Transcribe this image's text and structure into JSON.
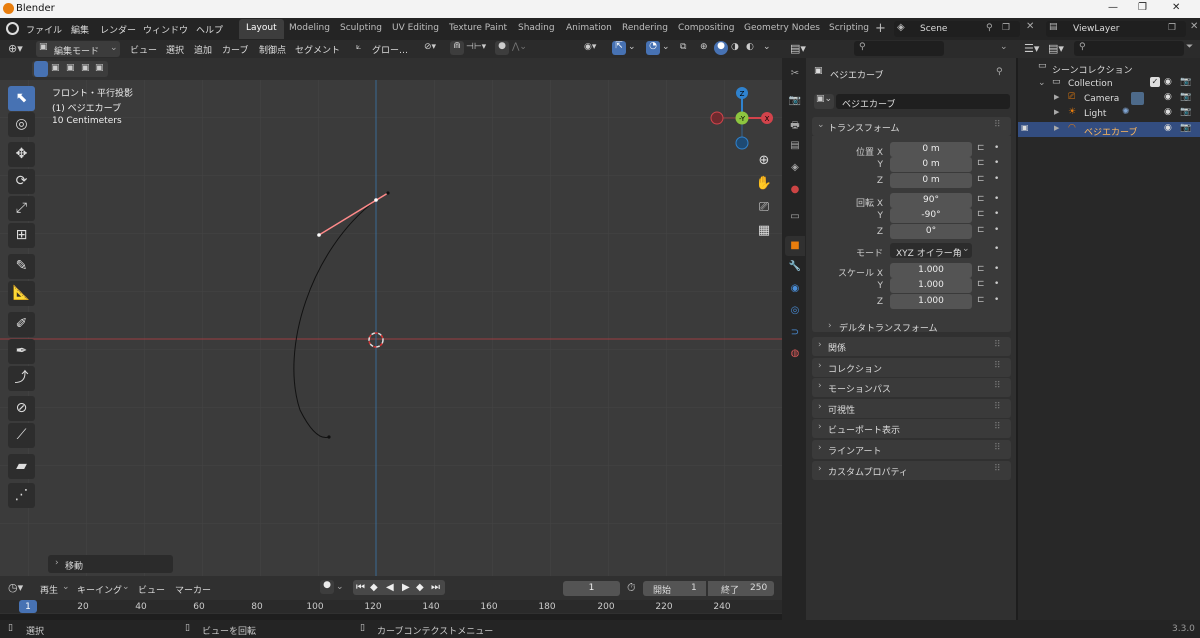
{
  "app": {
    "title": "Blender",
    "version": "3.3.0"
  },
  "menus": [
    "ファイル",
    "編集",
    "レンダー",
    "ウィンドウ",
    "ヘルプ"
  ],
  "workspaces": [
    "Layout",
    "Modeling",
    "Sculpting",
    "UV Editing",
    "Texture Paint",
    "Shading",
    "Animation",
    "Rendering",
    "Compositing",
    "Geometry Nodes",
    "Scripting"
  ],
  "active_workspace": "Layout",
  "scene": "Scene",
  "view_layer": "ViewLayer",
  "viewport_header": {
    "mode": "編集モード",
    "menus": [
      "ビュー",
      "選択",
      "追加",
      "カーブ",
      "制御点",
      "セグメント"
    ],
    "transform": "グロー…"
  },
  "overlay_text": {
    "view": "フロント・平行投影",
    "object": "(1) ベジエカーブ",
    "scale": "10 Centimeters"
  },
  "gizmo": {
    "z": "Z",
    "y": "-Y",
    "x": "X"
  },
  "operator_panel": "移動",
  "timeline": {
    "menus": [
      "再生",
      "キーイング",
      "ビュー",
      "マーカー"
    ],
    "current_frame": "1",
    "start_label": "開始",
    "start": "1",
    "end_label": "終了",
    "end": "250",
    "ticks": [
      "1",
      "20",
      "40",
      "60",
      "80",
      "100",
      "120",
      "140",
      "160",
      "180",
      "200",
      "220",
      "240"
    ]
  },
  "status": {
    "left": "選択",
    "mid": "ビューを回転",
    "right": "カーブコンテクストメニュー"
  },
  "properties": {
    "object_name": "ベジエカーブ",
    "data_name": "ベジエカーブ",
    "transform_header": "トランスフォーム",
    "location_label": "位置 X",
    "location": [
      "0 m",
      "0 m",
      "0 m"
    ],
    "rotation_label": "回転 X",
    "rotation": [
      "90°",
      "-90°",
      "0°"
    ],
    "mode_label": "モード",
    "mode_value": "XYZ オイラー角",
    "scale_label": "スケール X",
    "scale": [
      "1.000",
      "1.000",
      "1.000"
    ],
    "axis_y": "Y",
    "axis_z": "Z",
    "delta": "デルタトランスフォーム",
    "panels": [
      "関係",
      "コレクション",
      "モーションパス",
      "可視性",
      "ビューポート表示",
      "ラインアート",
      "カスタムプロパティ"
    ]
  },
  "outliner": {
    "root": "シーンコレクション",
    "collection": "Collection",
    "items": [
      "Camera",
      "Light",
      "ベジエカーブ"
    ]
  },
  "colors": {
    "accent": "#4772b3",
    "x_axis": "#d3434b",
    "y_axis": "#8dc63f",
    "z_axis": "#2f82ce",
    "curve_select": "#ff8a8a"
  }
}
